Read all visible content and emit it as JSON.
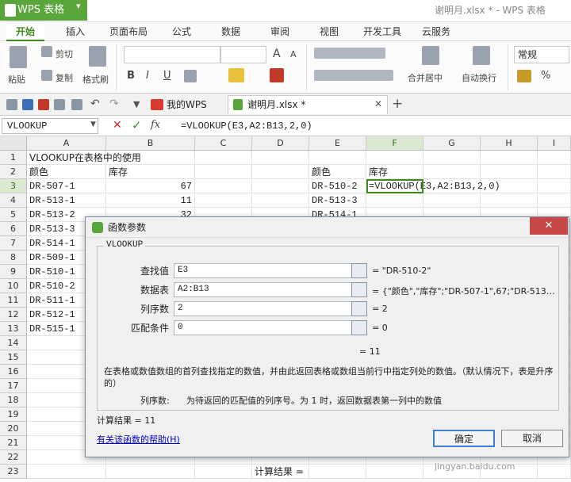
{
  "app": {
    "name": "WPS 表格",
    "window_title": "谢明月.xlsx * - WPS 表格"
  },
  "ribbon_tabs": [
    "开始",
    "插入",
    "页面布局",
    "公式",
    "数据",
    "审阅",
    "视图",
    "开发工具",
    "云服务"
  ],
  "ribbon": {
    "paste": "粘贴",
    "cut": "剪切",
    "copy": "复制",
    "format_painter": "格式刷",
    "merge": "合并居中",
    "wrap": "自动换行",
    "number_format": "常规",
    "bold": "B",
    "italic": "I",
    "underline": "U",
    "font_size_up": "A",
    "font_size_down": "A",
    "percent": "%",
    "comma": ","
  },
  "doc_tabs": {
    "home": "我的WPS",
    "file": "谢明月.xlsx *",
    "add": "+"
  },
  "formula_bar": {
    "name_box": "VLOOKUP",
    "cancel": "✕",
    "enter": "✓",
    "fx": "fx",
    "formula": "=VLOOKUP(E3,A2:B13,2,0)"
  },
  "columns": [
    "A",
    "B",
    "C",
    "D",
    "E",
    "F",
    "G",
    "H",
    "I"
  ],
  "rows": [
    "1",
    "2",
    "3",
    "4",
    "5",
    "6",
    "7",
    "8",
    "9",
    "10",
    "11",
    "12",
    "13",
    "14",
    "15",
    "16",
    "17",
    "18",
    "19",
    "20",
    "21",
    "22",
    "23"
  ],
  "sheet": {
    "a1": "VLOOKUP在表格中的使用",
    "a2": "颜色",
    "b2": "库存",
    "col_a": [
      "DR-507-1",
      "DR-513-1",
      "DR-513-2",
      "DR-513-3",
      "DR-514-1",
      "DR-509-1",
      "DR-510-1",
      "DR-510-2",
      "DR-511-1",
      "DR-512-1",
      "DR-515-1"
    ],
    "col_b": [
      "67",
      "11",
      "32"
    ],
    "e2": "颜色",
    "f2": "库存",
    "col_e": [
      "DR-510-2",
      "DR-513-3",
      "DR-514-1"
    ],
    "f3": "=VLOOKUP(E3,A2:B13,2,0)",
    "d23": "计算结果 ="
  },
  "dialog": {
    "title": "函数参数",
    "function_name": "VLOOKUP",
    "close": "✕",
    "params": [
      {
        "label": "查找值",
        "value": "E3",
        "result": "= \"DR-510-2\""
      },
      {
        "label": "数据表",
        "value": "A2:B13",
        "result": "= {\"颜色\",\"库存\";\"DR-507-1\",67;\"DR-513…"
      },
      {
        "label": "列序数",
        "value": "2",
        "result": "= 2"
      },
      {
        "label": "匹配条件",
        "value": "0",
        "result": "= 0"
      }
    ],
    "overall_result": "= 11",
    "description": "在表格或数值数组的首列查找指定的数值，并由此返回表格或数组当前行中指定列处的数值。（默认情况下，表是升序的）",
    "param_desc_label": "列序数:",
    "param_desc": "为待返回的匹配值的列序号。为 1 时，返回数据表第一列中的数值",
    "calc_result": "计算结果 = 11",
    "help_link": "有关该函数的帮助(H)",
    "ok": "确定",
    "cancel": "取消"
  },
  "watermark": "jingyan.baidu.com",
  "colors": {
    "accent": "#5aa63c",
    "link": "#0000cc"
  }
}
